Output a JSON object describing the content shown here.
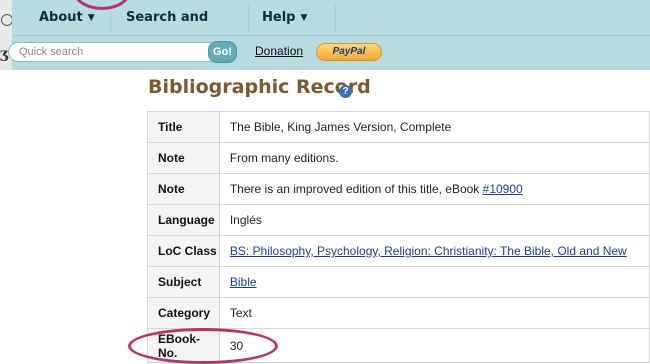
{
  "nav": {
    "items": [
      {
        "label": "About"
      },
      {
        "label": "Search and Browse"
      },
      {
        "label": "Help"
      }
    ]
  },
  "search": {
    "placeholder": "Quick search",
    "go_label": "Go!",
    "donation_label": "Donation",
    "paypal_label": "PayPal"
  },
  "page": {
    "title": "Bibliographic Record",
    "help_glyph": "?"
  },
  "record": {
    "rows": [
      {
        "label": "Title",
        "value": "The Bible, King James Version, Complete"
      },
      {
        "label": "Note",
        "value": "From many editions."
      },
      {
        "label": "Note",
        "value_prefix": "There is an improved edition of this title, eBook ",
        "link": "#10900"
      },
      {
        "label": "Language",
        "value": "Inglés"
      },
      {
        "label": "LoC Class",
        "link": "BS: Philosophy, Psychology, Religion: Christianity: The Bible, Old and New"
      },
      {
        "label": "Subject",
        "link": "Bible"
      },
      {
        "label": "Category",
        "value": "Text"
      },
      {
        "label": "EBook-No.",
        "value": "30"
      }
    ]
  },
  "colors": {
    "nav_bg": "#b8dbe0",
    "title_color": "#7b5a2e",
    "highlight_circle": "#b7336a",
    "link_color": "#1a3f8c"
  }
}
